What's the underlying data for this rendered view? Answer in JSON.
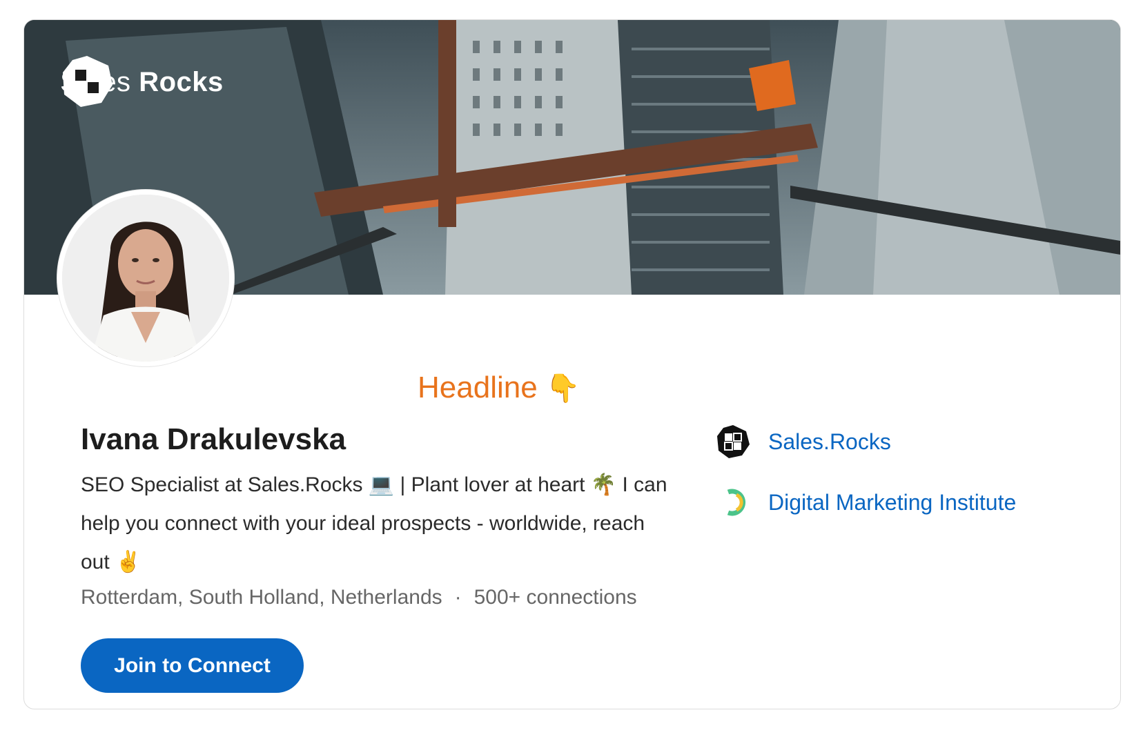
{
  "cover": {
    "brand": {
      "name_light": "Sales",
      "name_bold": "Rocks",
      "icon": "sales-rocks-logo-icon"
    }
  },
  "annotation": {
    "label": "Headline",
    "icon": "pointing-down-hand-emoji"
  },
  "profile": {
    "name": "Ivana Drakulevska",
    "headline": "SEO Specialist at Sales.Rocks 💻 | Plant lover at heart 🌴 I can help you connect with your ideal prospects - worldwide, reach out ✌️",
    "location": "Rotterdam, South Holland, Netherlands",
    "separator": "·",
    "connections": "500+ connections",
    "join_label": "Join to Connect"
  },
  "side": {
    "items": [
      {
        "label": "Sales.Rocks",
        "icon": "sales-rocks-company-icon"
      },
      {
        "label": "Digital Marketing Institute",
        "icon": "digital-marketing-institute-icon"
      }
    ]
  },
  "colors": {
    "accent": "#0a66c2",
    "annotation": "#e8731c",
    "text": "#1d1d1d",
    "muted": "#666666"
  }
}
